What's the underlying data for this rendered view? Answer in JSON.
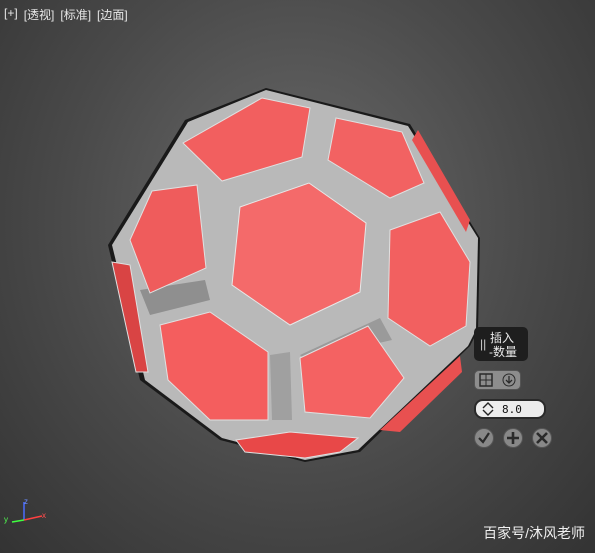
{
  "viewport": {
    "labels": [
      "[+]",
      "[透视]",
      "[标准]",
      "[边面]"
    ]
  },
  "caddy": {
    "title_line1": "插入",
    "title_line2": "-数量",
    "mode_icons": [
      "polygon-group-icon",
      "dropdown-arrow-icon"
    ],
    "amount_value": "8.0",
    "buttons": [
      "ok-check-icon",
      "apply-plus-icon",
      "cancel-x-icon"
    ]
  },
  "axis": {
    "x": "x",
    "y": "y",
    "z": "z"
  },
  "watermark": "百家号/沐风老师",
  "colors": {
    "face_red": "#f46060",
    "inset_gray": "#bdbdbd",
    "edge_dark": "#1a1a1a"
  }
}
